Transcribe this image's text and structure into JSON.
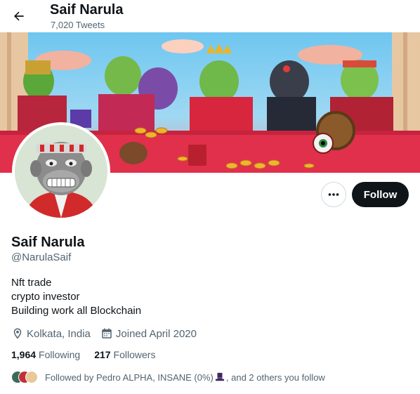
{
  "header": {
    "title": "Saif Narula",
    "tweet_count": "7,020 Tweets"
  },
  "profile": {
    "name": "Saif Narula",
    "handle": "@NarulaSaif",
    "bio_lines": [
      "Nft trade",
      "crypto investor",
      "Building work all Blockchain"
    ],
    "location": "Kolkata, India",
    "joined": "Joined April 2020",
    "following_count": "1,964",
    "following_label": "Following",
    "followers_count": "217",
    "followers_label": "Followers",
    "followed_by_prefix": "Followed by Pedro ALPHA, INSANE (0%)",
    "followed_by_suffix": ", and 2 others you follow"
  },
  "actions": {
    "more_label": "•••",
    "follow_label": "Follow"
  },
  "icons": {
    "back": "arrow-left-icon",
    "more": "more-dots-icon",
    "location": "location-pin-icon",
    "calendar": "calendar-icon",
    "hat": "top-hat-emoji"
  },
  "colors": {
    "text_primary": "#0f1419",
    "text_secondary": "#536471",
    "follow_button": "#0f1419",
    "border": "#cfd9de"
  }
}
